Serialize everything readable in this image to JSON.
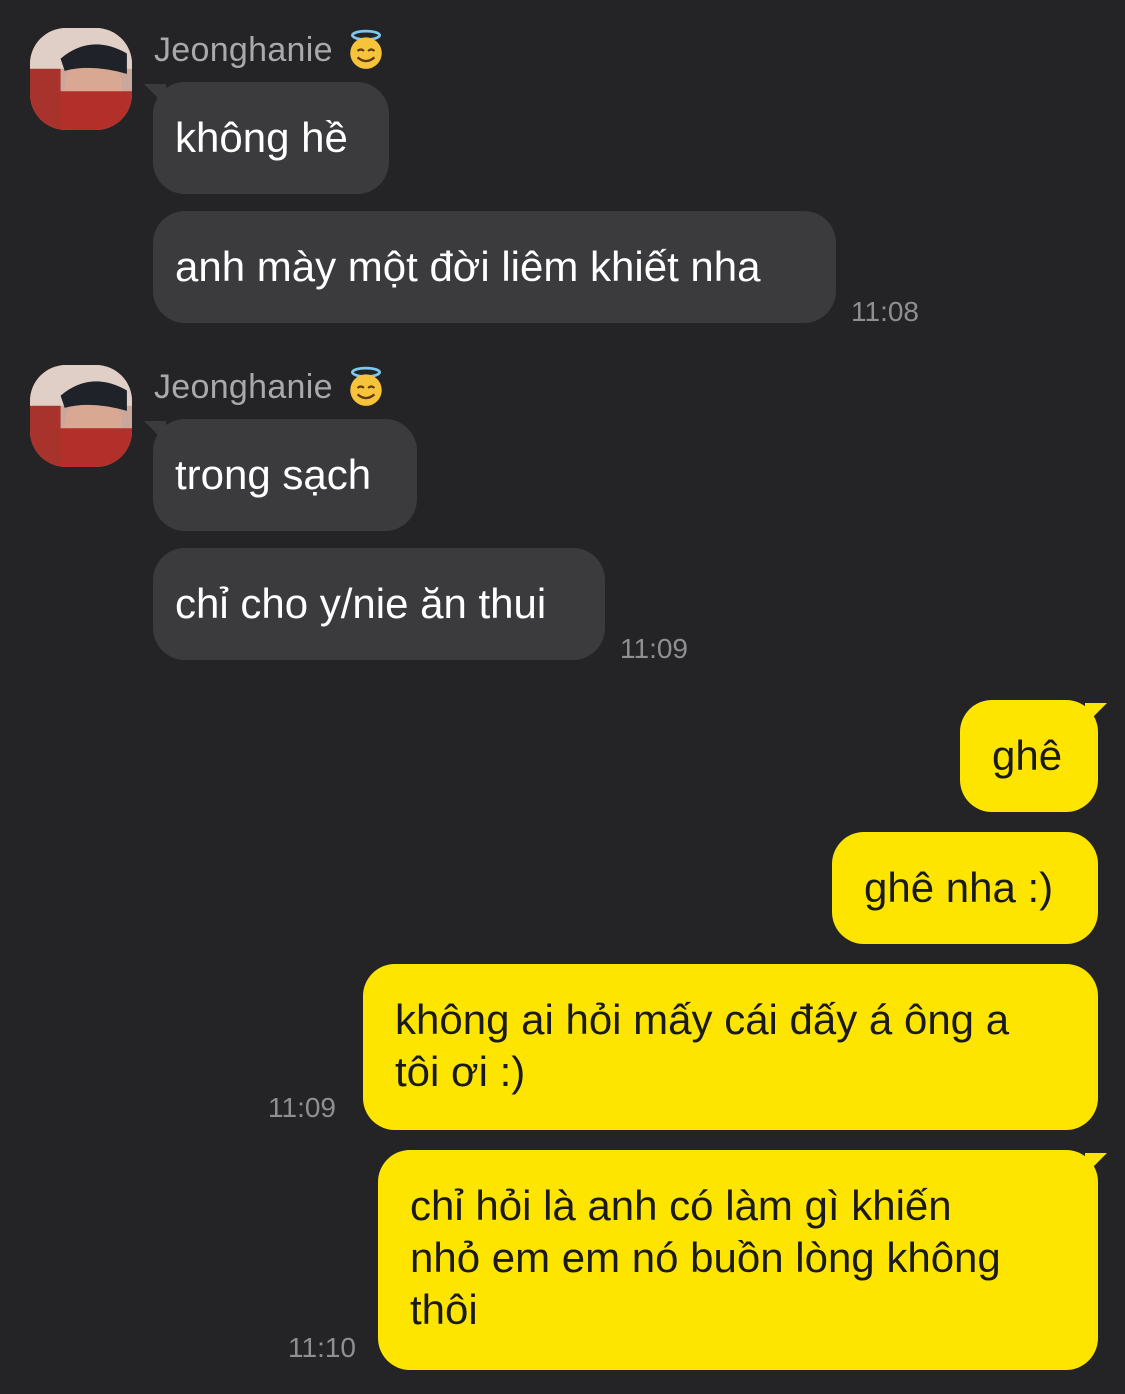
{
  "chat": {
    "incoming": [
      {
        "sender": "Jeonghanie",
        "sender_emoji": "smiling-face-with-halo-emoji",
        "messages": [
          "không hề",
          "anh mày một đời liêm khiết nha"
        ],
        "time": "11:08"
      },
      {
        "sender": "Jeonghanie",
        "sender_emoji": "smiling-face-with-halo-emoji",
        "messages": [
          "trong sạch",
          "chỉ cho y/nie ăn thui"
        ],
        "time": "11:09"
      }
    ],
    "outgoing": [
      {
        "messages": [
          {
            "lines": [
              "ghê"
            ]
          },
          {
            "lines": [
              "ghê nha :)"
            ]
          },
          {
            "lines": [
              "không ai hỏi mấy cái đấy á ông a",
              "tôi ơi :)"
            ]
          }
        ],
        "time": "11:09"
      },
      {
        "messages": [
          {
            "lines": [
              "chỉ hỏi là anh có làm gì khiến",
              "nhỏ em em nó buồn lòng không",
              "thôi"
            ]
          }
        ],
        "time": "11:10"
      }
    ]
  },
  "colors": {
    "background": "#242426",
    "incoming_bubble": "#3b3b3e",
    "outgoing_bubble": "#fee500",
    "timestamp": "#8e8e93",
    "sender_name": "#a9a9ad"
  }
}
